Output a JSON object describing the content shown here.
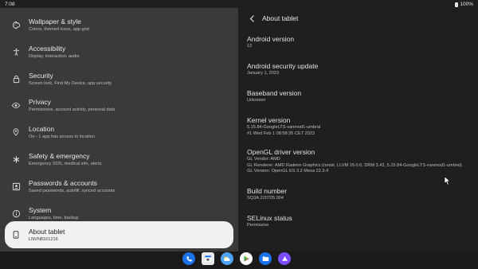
{
  "status_bar": {
    "time": "7:08",
    "battery": "100%"
  },
  "settings_menu": [
    {
      "title": "Wallpaper & style",
      "subtitle": "Colors, themed icons, app grid",
      "icon": "palette-icon"
    },
    {
      "title": "Accessibility",
      "subtitle": "Display, interaction, audio",
      "icon": "accessibility-icon"
    },
    {
      "title": "Security",
      "subtitle": "Screen lock, Find My Device, app security",
      "icon": "lock-icon"
    },
    {
      "title": "Privacy",
      "subtitle": "Permissions, account activity, personal data",
      "icon": "eye-icon"
    },
    {
      "title": "Location",
      "subtitle": "On - 1 app has access to location",
      "icon": "location-pin-icon"
    },
    {
      "title": "Safety & emergency",
      "subtitle": "Emergency SOS, medical info, alerts",
      "icon": "asterisk-icon"
    },
    {
      "title": "Passwords & accounts",
      "subtitle": "Saved passwords, autofill, synced accounts",
      "icon": "account-box-icon"
    },
    {
      "title": "System",
      "subtitle": "Languages, time, backup",
      "icon": "info-icon"
    },
    {
      "title": "About tablet",
      "subtitle": "LNVN8161216",
      "icon": "tablet-icon",
      "selected": true
    }
  ],
  "about_tablet": {
    "page_title": "About tablet",
    "entries": [
      {
        "title": "Android version",
        "values": [
          "12"
        ]
      },
      {
        "title": "Android security update",
        "values": [
          "January 1, 2023"
        ]
      },
      {
        "title": "Baseband version",
        "values": [
          "Unknown"
        ]
      },
      {
        "title": "Kernel version",
        "values": [
          "5.15.84-GoogleLTS-xanmod1-umbral",
          "#1 Wed Feb 1 08:58:35 CET 2023"
        ]
      },
      {
        "title": "OpenGL driver version",
        "values": [
          "GL Vendor: AMD",
          "GL Renderer: AMD Radeon Graphics (renoir, LLVM 15.0.6, DRM 3.42, 5.15.84-GoogleLTS-xanmod1-umbral)",
          "GL Version: OpenGL ES 3.2 Mesa 22.3.4"
        ]
      },
      {
        "title": "Build number",
        "values": [
          "SQ3A.220705.004"
        ]
      },
      {
        "title": "SELinux status",
        "values": [
          "Permissive"
        ]
      }
    ]
  },
  "dock": [
    {
      "name": "phone-app",
      "color": "#1a73e8"
    },
    {
      "name": "calendar-app",
      "color": "#e8eaed"
    },
    {
      "name": "weather-app",
      "color": "#4fa3f7"
    },
    {
      "name": "play-store-app",
      "color": "#ffffff"
    },
    {
      "name": "files-app",
      "color": "#1a73e8"
    },
    {
      "name": "play-games-app",
      "color": "#7c4dff"
    }
  ]
}
